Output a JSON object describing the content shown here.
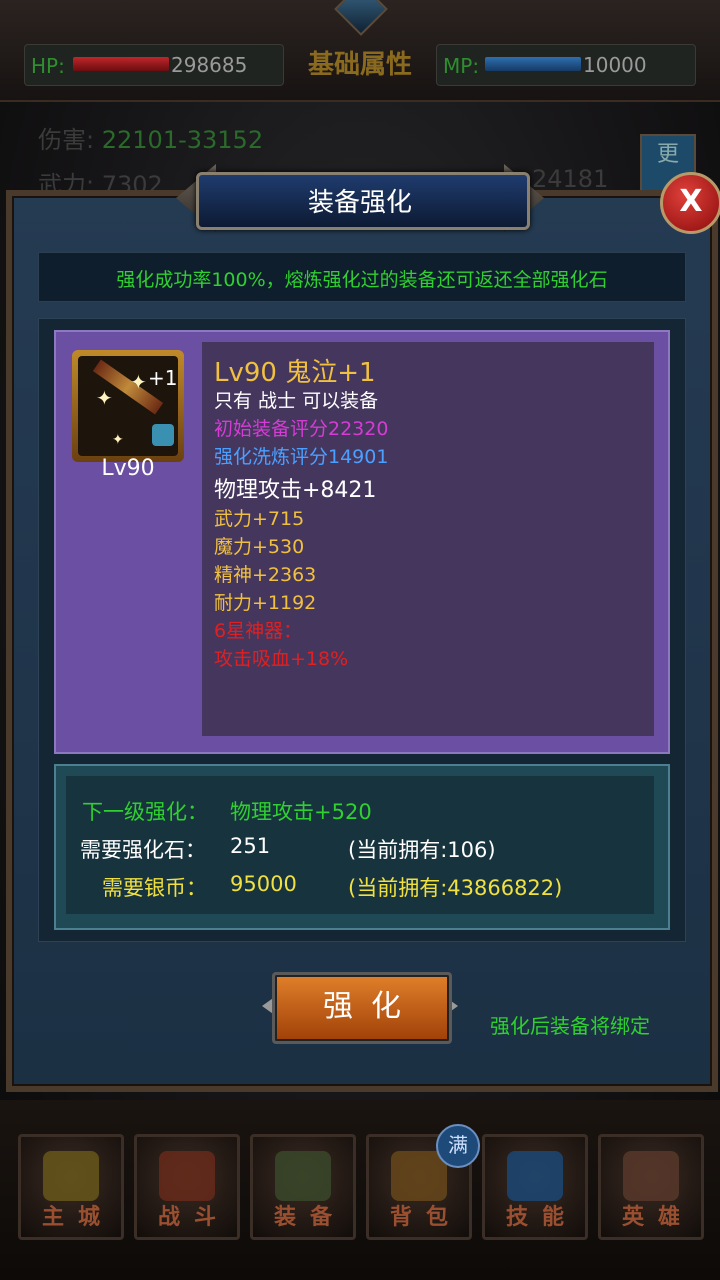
{
  "top": {
    "hp_label": "HP:",
    "hp_value": "298685",
    "title": "基础属性",
    "mp_label": "MP:",
    "mp_value": "10000",
    "damage_label": "伤害:",
    "damage_value": "22101-33152",
    "wuli_label": "武力:",
    "wuli_value": "7302",
    "right_value": "24181",
    "more_label": "更"
  },
  "dialog": {
    "title": "装备强化",
    "close_label": "X",
    "notice": "强化成功率100%，熔炼强化过的装备还可返还全部强化石"
  },
  "item": {
    "icon_plus": "+1",
    "icon_level": "Lv90",
    "name": "Lv90 鬼泣+1",
    "restriction": "只有 战士 可以装备",
    "base_score": "初始装备评分22320",
    "enhance_score": "强化洗炼评分14901",
    "main_attr": "物理攻击+8421",
    "attrs": [
      "武力+715",
      "魔力+530",
      "精神+2363",
      "耐力+1192"
    ],
    "artifact_title": "6星神器：",
    "artifact_effect": "攻击吸血+18%"
  },
  "next": {
    "next_label": "下一级强化：",
    "next_value": "物理攻击+520",
    "stone_label": "需要强化石：",
    "stone_value": "251",
    "stone_own": "(当前拥有:106)",
    "silver_label": "需要银币：",
    "silver_value": "95000",
    "silver_own": "(当前拥有:43866822)"
  },
  "action": {
    "enhance_label": "强化",
    "bind_note": "强化后装备将绑定"
  },
  "nav": {
    "badge": "满",
    "items": [
      "主城",
      "战斗",
      "装备",
      "背包",
      "技能",
      "英雄"
    ]
  },
  "colors": {
    "green": "#2fd02f",
    "gold": "#f0c040",
    "magenta": "#d43cd4",
    "blue": "#4aa0ff",
    "red": "#e02020"
  }
}
